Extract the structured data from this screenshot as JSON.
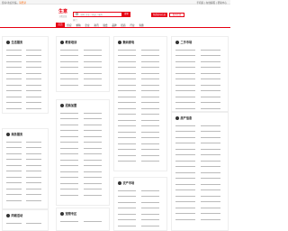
{
  "topbar": {
    "left": "您好!欢迎光临，",
    "highlight": "请登录",
    "right": "手机版 | 在线客服 | 帮助中心"
  },
  "header": {
    "logo_title": "生意",
    "logo_subtitle": "分类信息",
    "search_placeholder": "搜索 企业 / 商品 / 服务",
    "search_button": "搜索",
    "hot_words": "热门：",
    "post_button": "免费发布信息",
    "post_button2": "发布信息"
  },
  "nav": {
    "items": [
      "首页",
      "供应",
      "求购",
      "企业",
      "资讯",
      "展会",
      "品牌",
      "招商",
      "行业",
      "专题"
    ]
  },
  "cards": [
    {
      "title": "生活服务"
    },
    {
      "title": "商务服务"
    },
    {
      "title": "同城活动"
    },
    {
      "title": "教育培训"
    },
    {
      "title": "招商加盟"
    },
    {
      "title": "宠物专区"
    },
    {
      "title": "数码家电"
    },
    {
      "title": "农产市场"
    },
    {
      "title": "二手市场"
    },
    {
      "title": "房产信息"
    },
    {
      "title": "汽车市场"
    },
    {
      "title": "手机数码"
    },
    {
      "title": "企业招聘"
    },
    {
      "title": "本地商家"
    }
  ]
}
